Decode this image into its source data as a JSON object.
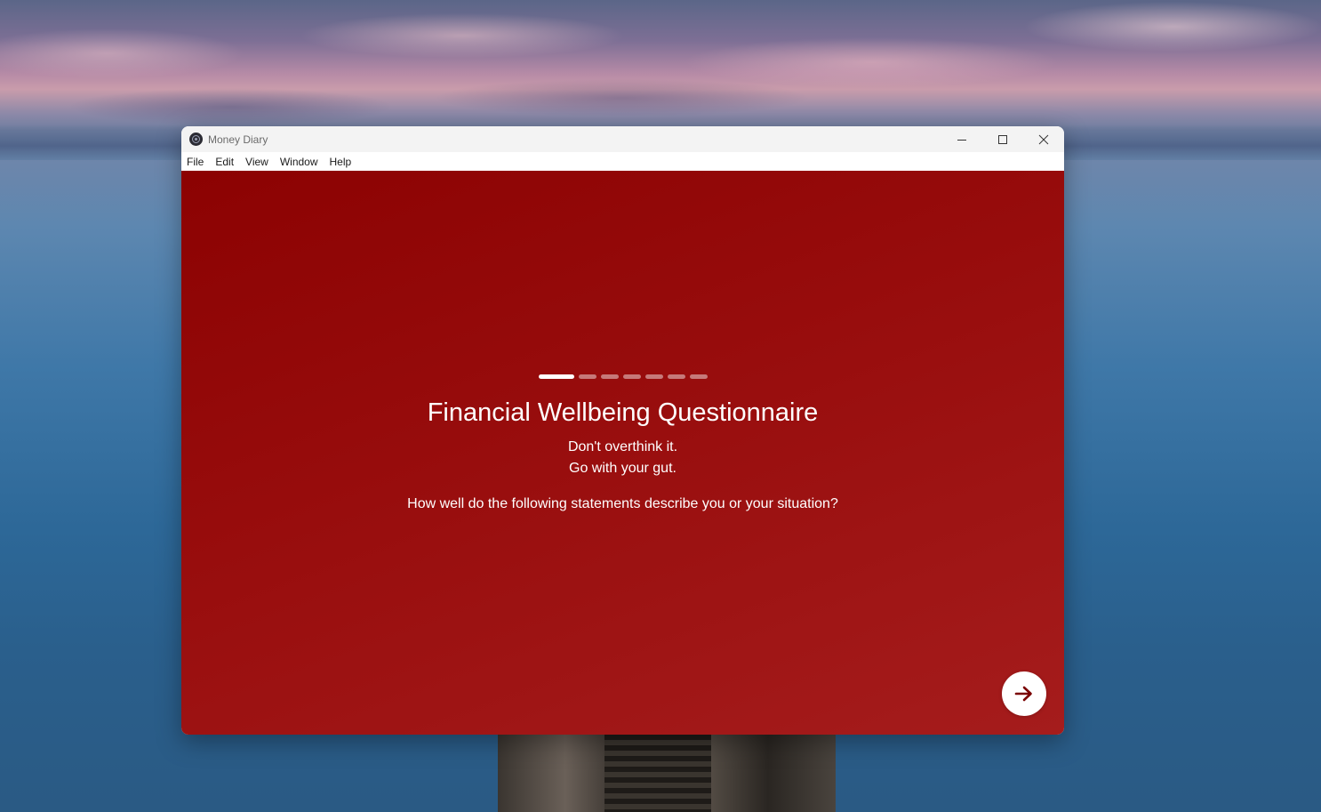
{
  "window": {
    "title": "Money Diary"
  },
  "menu": {
    "items": [
      "File",
      "Edit",
      "View",
      "Window",
      "Help"
    ]
  },
  "questionnaire": {
    "progress": {
      "current_step": 1,
      "total_steps": 7
    },
    "title": "Financial Wellbeing Questionnaire",
    "subtitle_line1": "Don't overthink it.",
    "subtitle_line2": "Go with your gut.",
    "prompt": "How well do the following statements describe you or your situation?"
  },
  "icons": {
    "app": "app-logo-icon",
    "minimize": "minimize-icon",
    "maximize": "maximize-icon",
    "close": "close-icon",
    "next": "arrow-right-icon"
  },
  "colors": {
    "content_bg_start": "#8c0202",
    "content_bg_end": "#a51c1c",
    "accent": "#7a0000"
  }
}
